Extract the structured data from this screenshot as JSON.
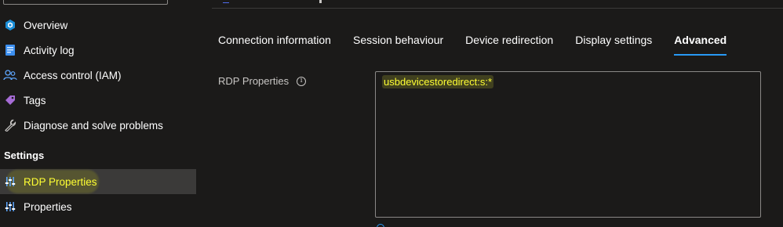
{
  "sidebar": {
    "items": [
      {
        "label": "Overview",
        "icon": "overview-icon"
      },
      {
        "label": "Activity log",
        "icon": "activity-log-icon"
      },
      {
        "label": "Access control (IAM)",
        "icon": "people-icon"
      },
      {
        "label": "Tags",
        "icon": "tag-icon"
      },
      {
        "label": "Diagnose and solve problems",
        "icon": "wrench-icon"
      }
    ],
    "section_header": "Settings",
    "settings_items": [
      {
        "label": "RDP Properties",
        "icon": "sliders-icon",
        "selected": true
      },
      {
        "label": "Properties",
        "icon": "sliders-icon",
        "selected": false
      }
    ]
  },
  "tabs": [
    {
      "label": "Connection information",
      "active": false
    },
    {
      "label": "Session behaviour",
      "active": false
    },
    {
      "label": "Device redirection",
      "active": false
    },
    {
      "label": "Display settings",
      "active": false
    },
    {
      "label": "Advanced",
      "active": true
    }
  ],
  "form": {
    "rdp_label": "RDP Properties",
    "info_glyph": "i",
    "rdp_value": "usbdevicestoredirect:s:*"
  },
  "colors": {
    "background": "#1b1a19",
    "highlight_text": "#ffff33",
    "accent": "#2899f5",
    "selected_bg": "#3b3a39"
  }
}
